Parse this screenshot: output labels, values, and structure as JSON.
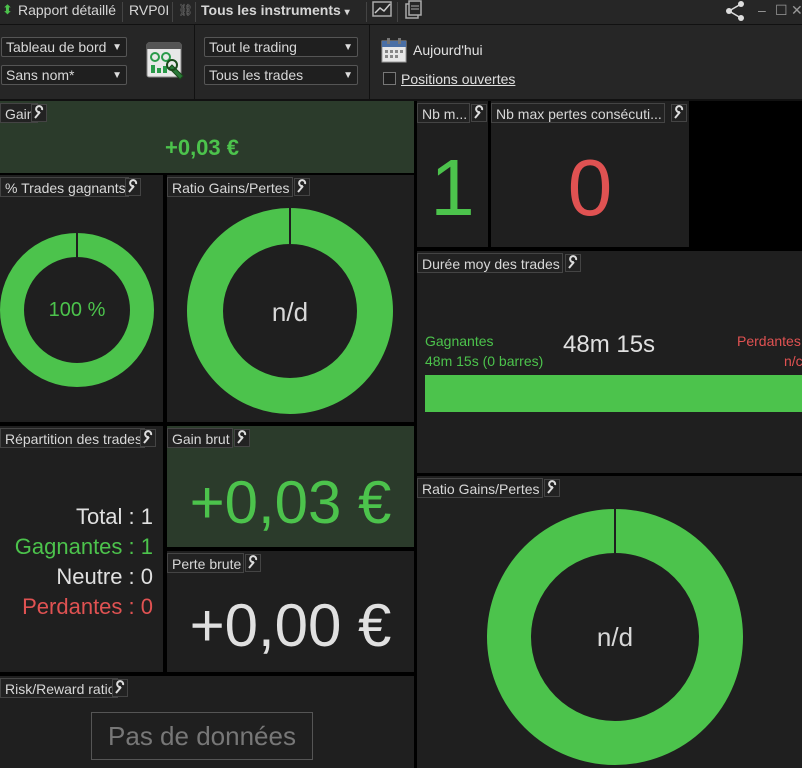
{
  "topbar": {
    "report_label": "Rapport détaillé",
    "account": "RVP0I",
    "instruments": "Tous les instruments"
  },
  "toolbar": {
    "dashboard_select": "Tableau de bord",
    "name_select": "Sans nom*",
    "trading_select": "Tout le trading",
    "trades_select": "Tous les trades",
    "date_label": "Aujourd'hui",
    "open_positions_label": "Positions ouvertes",
    "open_positions_checked": false
  },
  "panels": {
    "gain": {
      "title": "Gain",
      "value": "+0,03 €"
    },
    "win_pct": {
      "title": "% Trades gagnants",
      "value": "100 %",
      "fraction": 1.0
    },
    "ratio1": {
      "title": "Ratio Gains/Pertes",
      "value": "n/d",
      "fraction": 1.0
    },
    "nb_max_wins": {
      "title": "Nb m...",
      "value": "1"
    },
    "nb_max_losses": {
      "title": "Nb max pertes consécuti...",
      "value": "0"
    },
    "avg_duration": {
      "title": "Durée moy des trades",
      "total": "48m 15s",
      "winners_label": "Gagnantes",
      "winners_detail": "48m 15s (0 barres)",
      "losers_label": "Perdantes",
      "losers_detail": "n/c"
    },
    "breakdown": {
      "title": "Répartition des trades",
      "total": "Total : 1",
      "winners": "Gagnantes : 1",
      "neutral": "Neutre : 0",
      "losers": "Perdantes : 0"
    },
    "gross_gain": {
      "title": "Gain brut",
      "value": "+0,03 €"
    },
    "gross_loss": {
      "title": "Perte brute",
      "value": "+0,00 €"
    },
    "ratio2": {
      "title": "Ratio Gains/Pertes",
      "value": "n/d",
      "fraction": 1.0
    },
    "risk_reward": {
      "title": "Risk/Reward ratio",
      "value": "Pas de données"
    }
  },
  "colors": {
    "green": "#4cc34c",
    "red": "#e05252",
    "panel_bg": "#1f1f1f",
    "gain_bg": "#2b3b2b"
  }
}
